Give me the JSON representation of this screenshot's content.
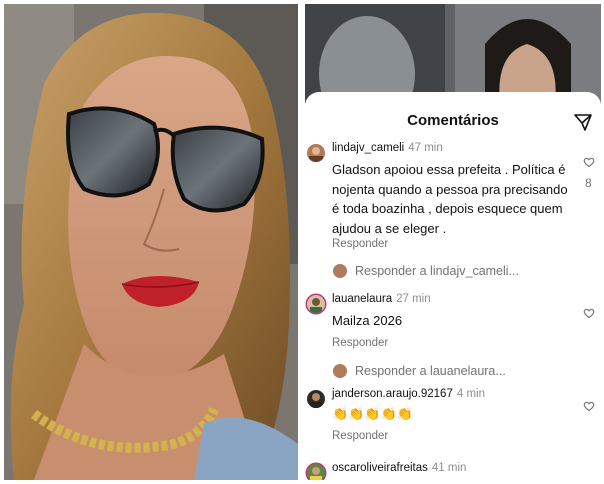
{
  "sheet": {
    "title": "Comentários",
    "send_icon": "send-icon"
  },
  "comments": [
    {
      "username": "lindajv_cameli",
      "time": "47 min",
      "text": "Gladson apoiou essa prefeita . Política é nojenta quando a pessoa pra precisando é toda boazinha , depois esquece quem ajudou a se eleger .",
      "reply_label": "Responder",
      "likes": "8",
      "reply_prompt": "Responder a lindajv_cameli..."
    },
    {
      "username": "lauanelaura",
      "time": "27 min",
      "text": "Mailza 2026",
      "reply_label": "Responder",
      "reply_prompt": "Responder a lauanelaura..."
    },
    {
      "username": "janderson.araujo.92167",
      "time": "4 min",
      "text": "👏👏👏👏👏",
      "reply_label": "Responder"
    },
    {
      "username": "oscaroliveirafreitas",
      "time": "41 min"
    }
  ],
  "colors": {
    "text": "#111111",
    "muted": "#737373",
    "time": "#8e8e8e",
    "story_ring": "#c13584"
  },
  "icons": [
    "send-icon",
    "heart-outline-icon"
  ]
}
